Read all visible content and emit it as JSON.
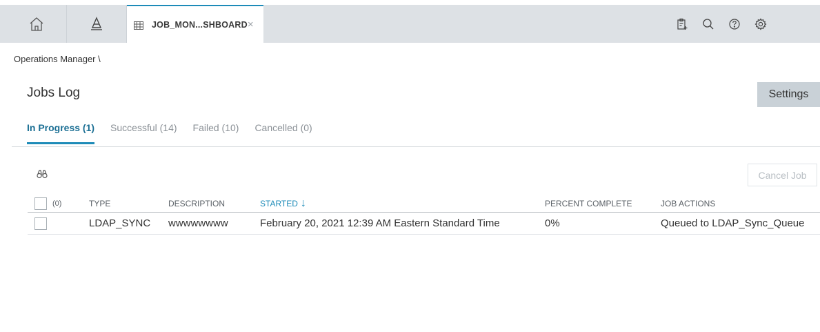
{
  "topbar": {
    "nav": [
      {
        "name": "home-icon"
      },
      {
        "name": "asset-hierarchy-icon"
      }
    ],
    "active_tab": {
      "icon": "grid-icon",
      "label": "JOB_MON...SHBOARD",
      "close": "×"
    },
    "right_icons": [
      "clipboard-add-icon",
      "search-icon",
      "help-icon",
      "gear-icon"
    ]
  },
  "breadcrumb": "Operations Manager \\",
  "page": {
    "title": "Jobs Log",
    "settings_label": "Settings"
  },
  "tabs": [
    {
      "label": "In Progress (1)",
      "active": true
    },
    {
      "label": "Successful (14)",
      "active": false
    },
    {
      "label": "Failed (10)",
      "active": false
    },
    {
      "label": "Cancelled (0)",
      "active": false
    }
  ],
  "toolbar": {
    "find_icon": "binoculars-icon",
    "cancel_job_label": "Cancel Job"
  },
  "grid": {
    "selected_count": "(0)",
    "columns": [
      "TYPE",
      "DESCRIPTION",
      "STARTED",
      "PERCENT COMPLETE",
      "JOB ACTIONS"
    ],
    "sort_indicator": "↓",
    "rows": [
      {
        "type": "LDAP_SYNC",
        "description": "wwwwwwww",
        "started": "February 20, 2021 12:39 AM Eastern Standard Time",
        "percent_complete": "0%",
        "job_actions": "Queued to LDAP_Sync_Queue"
      }
    ]
  },
  "colors": {
    "accent": "#1d8bb8",
    "topbar_bg": "#dde1e5",
    "settings_bg": "#c9d1d7"
  }
}
